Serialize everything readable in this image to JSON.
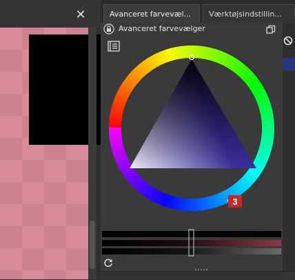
{
  "canvas": {
    "close_glyph": "✕"
  },
  "tabs": [
    {
      "label": "Avanceret farvevæl...",
      "active": true
    },
    {
      "label": "Værktøjsindstillin...",
      "active": false
    }
  ],
  "docker": {
    "title": "Avanceret farvevælger",
    "close_glyph": "✕",
    "icons": [
      "lock-icon",
      "float-icon",
      "close-icon",
      "settings-icon",
      "refresh-icon",
      "no-entry-icon"
    ]
  },
  "selector": {
    "current_color": "#3a2f9e",
    "marker_label": "3"
  },
  "colors": {
    "accent": "#c62828",
    "background": "#3a3a3a"
  }
}
